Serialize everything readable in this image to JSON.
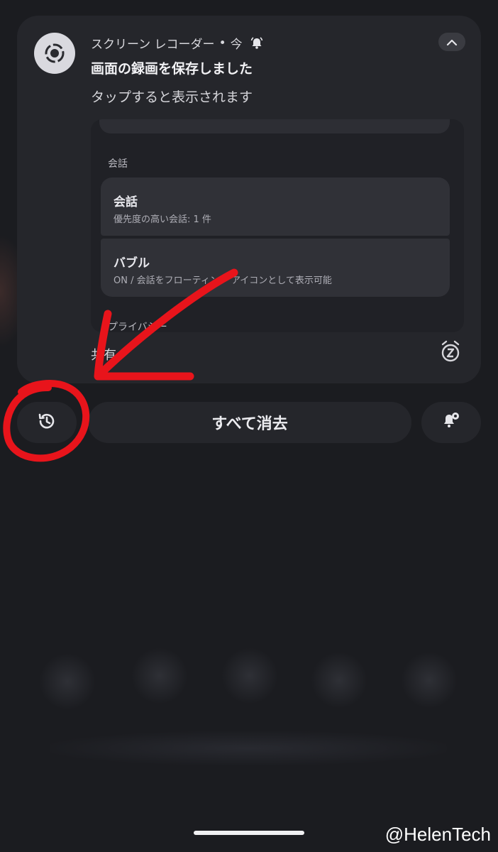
{
  "notification": {
    "app_name": "スクリーン レコーダー",
    "separator": "•",
    "time": "今",
    "title": "画面の録画を保存しました",
    "text": "タップすると表示されます",
    "preview": {
      "section_label": "会話",
      "items": [
        {
          "title": "会話",
          "subtitle": "優先度の高い会話: 1 件"
        },
        {
          "title": "バブル",
          "subtitle": "ON / 会話をフローティング アイコンとして表示可能"
        }
      ],
      "section_label_2": "プライバシー"
    },
    "action_label": "共有"
  },
  "actions": {
    "clear_all_label": "すべて消去"
  },
  "icons": {
    "app": "screen-recorder-icon",
    "alert": "bell-icon",
    "collapse": "chevron-up-icon",
    "snooze": "snooze-icon",
    "history": "history-icon",
    "settings": "notification-settings-icon"
  },
  "annotation": {
    "color": "#e8141b"
  },
  "watermark": "@HelenTech"
}
